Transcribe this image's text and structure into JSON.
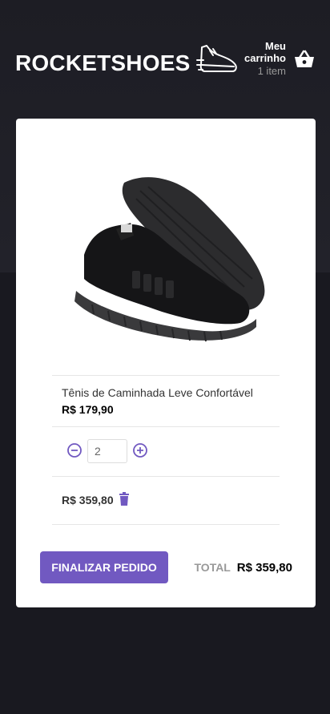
{
  "header": {
    "logo": "ROCKETSHOES",
    "cart_title": "Meu carrinho",
    "cart_count": "1 item"
  },
  "product": {
    "title": "Tênis de Caminhada Leve Confortável",
    "price": "R$ 179,90",
    "quantity": "2",
    "subtotal": "R$ 359,80"
  },
  "footer": {
    "checkout_label": "FINALIZAR PEDIDO",
    "total_label": "TOTAL",
    "total_value": "R$ 359,80"
  },
  "colors": {
    "brand": "#7159c1",
    "background": "#191920"
  }
}
